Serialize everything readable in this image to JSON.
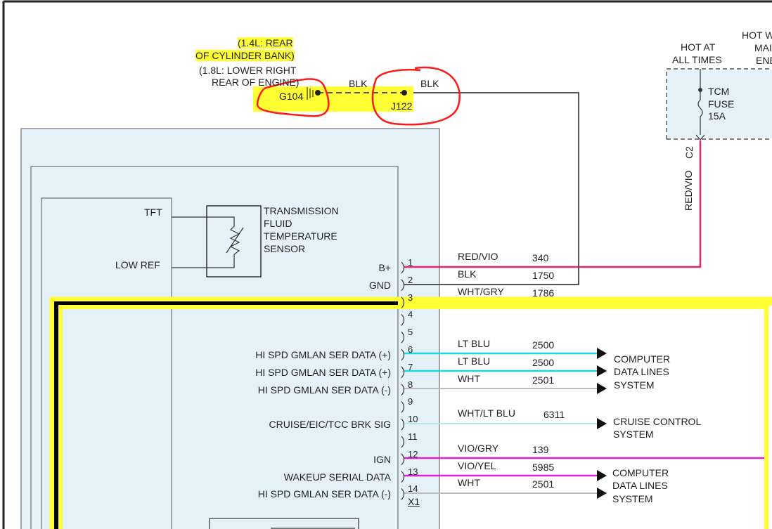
{
  "ground": {
    "location_14l": "(1.4L: REAR",
    "location_14l_2": "OF CYLINDER BANK)",
    "location_18l": "(1.8L: LOWER RIGHT",
    "location_18l_2": "REAR OF ENGINE)",
    "ground_id": "G104",
    "splice_id": "J122",
    "wire_left": "BLK",
    "wire_right": "BLK"
  },
  "fuse_block": {
    "hot_at_all_times": [
      "HOT AT",
      "ALL TIMES"
    ],
    "hot_with_partial": [
      "HOT W",
      "MAI",
      "ENE"
    ],
    "fuse_name": [
      "TCM",
      "FUSE",
      "15A"
    ],
    "connector": "C2",
    "wire_color": "RED/VIO"
  },
  "sensor": {
    "name": [
      "TRANSMISSION",
      "FLUID",
      "TEMPERATURE",
      "SENSOR"
    ],
    "tft": "TFT",
    "low_ref": "LOW REF"
  },
  "pins": [
    {
      "num": "1",
      "signal": "B+",
      "wire": "RED/VIO",
      "circuit": "340"
    },
    {
      "num": "2",
      "signal": "GND",
      "wire": "BLK",
      "circuit": "1750"
    },
    {
      "num": "3",
      "signal": "",
      "wire": "WHT/GRY",
      "circuit": "1786"
    },
    {
      "num": "4",
      "signal": "",
      "wire": "",
      "circuit": ""
    },
    {
      "num": "5",
      "signal": "",
      "wire": "",
      "circuit": ""
    },
    {
      "num": "6",
      "signal": "HI SPD GMLAN SER DATA (+)",
      "wire": "LT BLU",
      "circuit": "2500"
    },
    {
      "num": "7",
      "signal": "HI SPD GMLAN SER DATA (+)",
      "wire": "LT BLU",
      "circuit": "2500"
    },
    {
      "num": "8",
      "signal": "HI SPD GMLAN SER DATA (-)",
      "wire": "WHT",
      "circuit": "2501"
    },
    {
      "num": "9",
      "signal": "",
      "wire": "",
      "circuit": ""
    },
    {
      "num": "10",
      "signal": "CRUISE/EIC/TCC BRK SIG",
      "wire": "WHT/LT BLU",
      "circuit": "6311"
    },
    {
      "num": "11",
      "signal": "",
      "wire": "",
      "circuit": ""
    },
    {
      "num": "12",
      "signal": "IGN",
      "wire": "VIO/GRY",
      "circuit": "139"
    },
    {
      "num": "13",
      "signal": "WAKEUP SERIAL DATA",
      "wire": "VIO/YEL",
      "circuit": "5985"
    },
    {
      "num": "14",
      "signal": "HI SPD GMLAN SER DATA (-)",
      "wire": "WHT",
      "circuit": "2501"
    }
  ],
  "connector_x1": "X1",
  "destinations": {
    "computer_data_1": [
      "COMPUTER",
      "DATA LINES",
      "SYSTEM"
    ],
    "cruise_control": [
      "CRUISE CONTROL",
      "SYSTEM"
    ],
    "computer_data_2": [
      "COMPUTER",
      "DATA LINES",
      "SYSTEM"
    ]
  },
  "colors": {
    "red_vio": "#e8246a",
    "lt_blu": "#19d9e6",
    "vio": "#e61ec8",
    "blk": "#555555",
    "highlight": "#ffff33",
    "module_fill": "#e4f1f8",
    "annotation_red": "#ff1a1a"
  }
}
